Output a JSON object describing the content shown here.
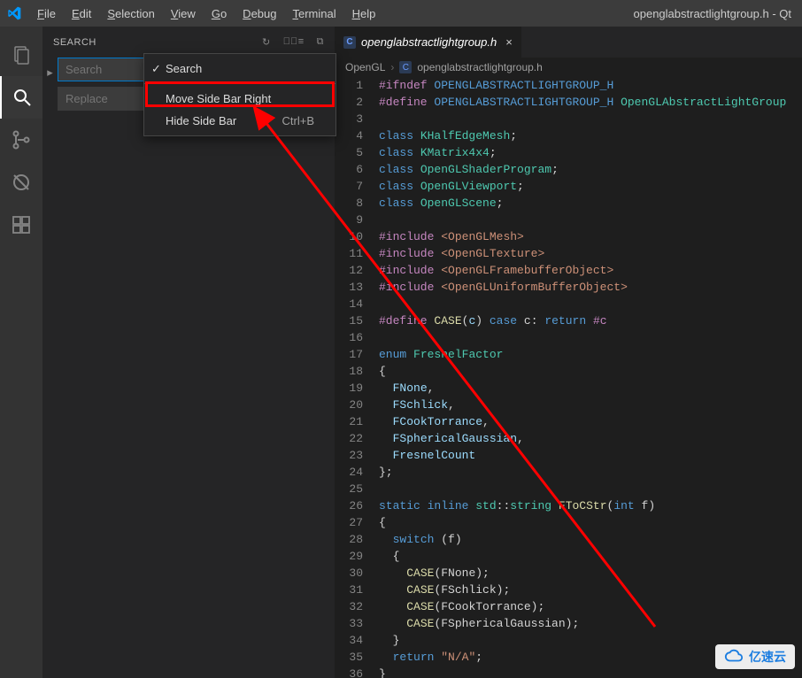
{
  "titlebar": {
    "menus": [
      "File",
      "Edit",
      "Selection",
      "View",
      "Go",
      "Debug",
      "Terminal",
      "Help"
    ],
    "title": "openglabstractlightgroup.h - Qt"
  },
  "activitybar": {
    "items": [
      {
        "name": "explorer-icon"
      },
      {
        "name": "search-icon"
      },
      {
        "name": "source-control-icon"
      },
      {
        "name": "debug-icon"
      },
      {
        "name": "extensions-icon"
      }
    ],
    "active_index": 1
  },
  "sidebar": {
    "title": "SEARCH",
    "search_placeholder": "Search",
    "replace_placeholder": "Replace"
  },
  "context_menu": {
    "items": [
      {
        "label": "Search",
        "checked": true
      },
      {
        "label": "Move Side Bar Right",
        "highlight": true
      },
      {
        "label": "Hide Side Bar",
        "shortcut": "Ctrl+B"
      }
    ]
  },
  "editor": {
    "tab": {
      "icon": "C",
      "filename": "openglabstractlightgroup.h"
    },
    "breadcrumb": [
      "OpenGL",
      "openglabstractlightgroup.h"
    ],
    "breadcrumb_icon": "C",
    "line_start": 1,
    "line_end": 36
  },
  "code_lines": [
    [
      {
        "c": "tok-pre",
        "t": "#ifndef"
      },
      {
        "t": " "
      },
      {
        "c": "tok-macro",
        "t": "OPENGLABSTRACTLIGHTGROUP_H"
      }
    ],
    [
      {
        "c": "tok-pre",
        "t": "#define"
      },
      {
        "t": " "
      },
      {
        "c": "tok-macro",
        "t": "OPENGLABSTRACTLIGHTGROUP_H"
      },
      {
        "t": " "
      },
      {
        "c": "tok-type",
        "t": "OpenGLAbstractLightGroup"
      }
    ],
    [],
    [
      {
        "c": "tok-key",
        "t": "class"
      },
      {
        "t": " "
      },
      {
        "c": "tok-type",
        "t": "KHalfEdgeMesh"
      },
      {
        "t": ";"
      }
    ],
    [
      {
        "c": "tok-key",
        "t": "class"
      },
      {
        "t": " "
      },
      {
        "c": "tok-type",
        "t": "KMatrix4x4"
      },
      {
        "t": ";"
      }
    ],
    [
      {
        "c": "tok-key",
        "t": "class"
      },
      {
        "t": " "
      },
      {
        "c": "tok-type",
        "t": "OpenGLShaderProgram"
      },
      {
        "t": ";"
      }
    ],
    [
      {
        "c": "tok-key",
        "t": "class"
      },
      {
        "t": " "
      },
      {
        "c": "tok-type",
        "t": "OpenGLViewport"
      },
      {
        "t": ";"
      }
    ],
    [
      {
        "c": "tok-key",
        "t": "class"
      },
      {
        "t": " "
      },
      {
        "c": "tok-type",
        "t": "OpenGLScene"
      },
      {
        "t": ";"
      }
    ],
    [],
    [
      {
        "c": "tok-pre",
        "t": "#include"
      },
      {
        "t": " "
      },
      {
        "c": "tok-inc",
        "t": "<OpenGLMesh>"
      }
    ],
    [
      {
        "c": "tok-pre",
        "t": "#include"
      },
      {
        "t": " "
      },
      {
        "c": "tok-inc",
        "t": "<OpenGLTexture>"
      }
    ],
    [
      {
        "c": "tok-pre",
        "t": "#include"
      },
      {
        "t": " "
      },
      {
        "c": "tok-inc",
        "t": "<OpenGLFramebufferObject>"
      }
    ],
    [
      {
        "c": "tok-pre",
        "t": "#include"
      },
      {
        "t": " "
      },
      {
        "c": "tok-inc",
        "t": "<OpenGLUniformBufferObject>"
      }
    ],
    [],
    [
      {
        "c": "tok-pre",
        "t": "#define"
      },
      {
        "t": " "
      },
      {
        "c": "tok-func",
        "t": "CASE"
      },
      {
        "t": "("
      },
      {
        "c": "tok-member",
        "t": "c"
      },
      {
        "t": ") "
      },
      {
        "c": "tok-key",
        "t": "case"
      },
      {
        "t": " c: "
      },
      {
        "c": "tok-key",
        "t": "return"
      },
      {
        "t": " "
      },
      {
        "c": "tok-pre",
        "t": "#c"
      }
    ],
    [],
    [
      {
        "c": "tok-enum",
        "t": "enum"
      },
      {
        "t": " "
      },
      {
        "c": "tok-type",
        "t": "FresnelFactor"
      }
    ],
    [
      {
        "t": "{"
      }
    ],
    [
      {
        "t": "  "
      },
      {
        "c": "tok-member",
        "t": "FNone"
      },
      {
        "t": ","
      }
    ],
    [
      {
        "t": "  "
      },
      {
        "c": "tok-member",
        "t": "FSchlick"
      },
      {
        "t": ","
      }
    ],
    [
      {
        "t": "  "
      },
      {
        "c": "tok-member",
        "t": "FCookTorrance"
      },
      {
        "t": ","
      }
    ],
    [
      {
        "t": "  "
      },
      {
        "c": "tok-member",
        "t": "FSphericalGaussian"
      },
      {
        "t": ","
      }
    ],
    [
      {
        "t": "  "
      },
      {
        "c": "tok-member",
        "t": "FresnelCount"
      }
    ],
    [
      {
        "t": "};"
      }
    ],
    [],
    [
      {
        "c": "tok-key",
        "t": "static"
      },
      {
        "t": " "
      },
      {
        "c": "tok-key",
        "t": "inline"
      },
      {
        "t": " "
      },
      {
        "c": "tok-type",
        "t": "std"
      },
      {
        "t": "::"
      },
      {
        "c": "tok-type",
        "t": "string"
      },
      {
        "t": " "
      },
      {
        "c": "tok-func",
        "t": "FToCStr"
      },
      {
        "t": "("
      },
      {
        "c": "tok-paramtype",
        "t": "int"
      },
      {
        "t": " f)"
      }
    ],
    [
      {
        "t": "{"
      }
    ],
    [
      {
        "t": "  "
      },
      {
        "c": "tok-key",
        "t": "switch"
      },
      {
        "t": " (f)"
      }
    ],
    [
      {
        "t": "  {"
      }
    ],
    [
      {
        "t": "    "
      },
      {
        "c": "tok-func",
        "t": "CASE"
      },
      {
        "t": "(FNone);"
      }
    ],
    [
      {
        "t": "    "
      },
      {
        "c": "tok-func",
        "t": "CASE"
      },
      {
        "t": "(FSchlick);"
      }
    ],
    [
      {
        "t": "    "
      },
      {
        "c": "tok-func",
        "t": "CASE"
      },
      {
        "t": "(FCookTorrance);"
      }
    ],
    [
      {
        "t": "    "
      },
      {
        "c": "tok-func",
        "t": "CASE"
      },
      {
        "t": "(FSphericalGaussian);"
      }
    ],
    [
      {
        "t": "  }"
      }
    ],
    [
      {
        "t": "  "
      },
      {
        "c": "tok-key",
        "t": "return"
      },
      {
        "t": " "
      },
      {
        "c": "tok-str",
        "t": "\"N/A\""
      },
      {
        "t": ";"
      }
    ],
    [
      {
        "t": "}"
      }
    ]
  ],
  "watermark": {
    "text": "亿速云"
  }
}
